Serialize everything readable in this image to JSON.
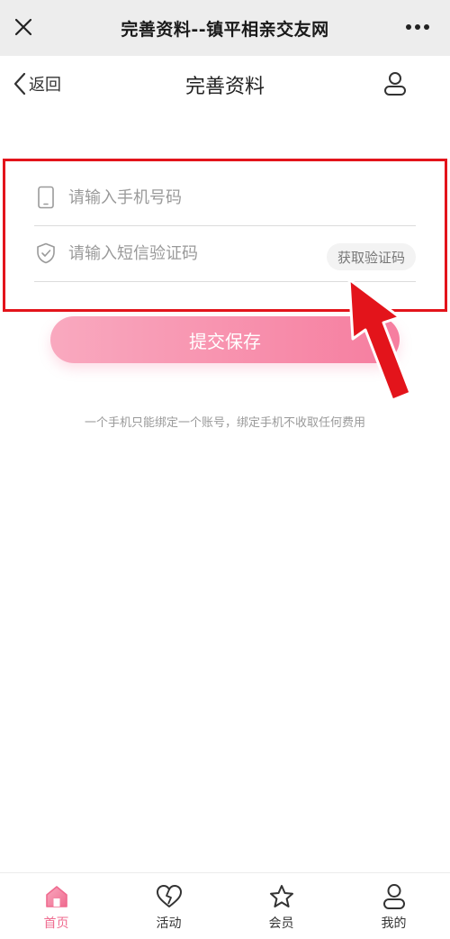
{
  "topbar": {
    "title": "完善资料--镇平相亲交友网",
    "close_icon": "close-icon",
    "more_icon": "more-icon"
  },
  "header": {
    "back_label": "返回",
    "title": "完善资料",
    "user_icon": "user-icon"
  },
  "form": {
    "phone_placeholder": "请输入手机号码",
    "phone_value": "",
    "code_placeholder": "请输入短信验证码",
    "code_value": "",
    "get_code_label": "获取验证码",
    "submit_label": "提交保存"
  },
  "note": "一个手机只能绑定一个账号，绑定手机不收取任何费用",
  "tabbar": {
    "items": [
      {
        "label": "首页",
        "icon": "home-icon",
        "active": true
      },
      {
        "label": "活动",
        "icon": "heart-icon",
        "active": false
      },
      {
        "label": "会员",
        "icon": "star-icon",
        "active": false
      },
      {
        "label": "我的",
        "icon": "user-icon",
        "active": false
      }
    ]
  },
  "colors": {
    "accent": "#ef6b8f",
    "button_start": "#f9a9bf",
    "button_end": "#f67d9f",
    "highlight_red": "#e3141b"
  }
}
